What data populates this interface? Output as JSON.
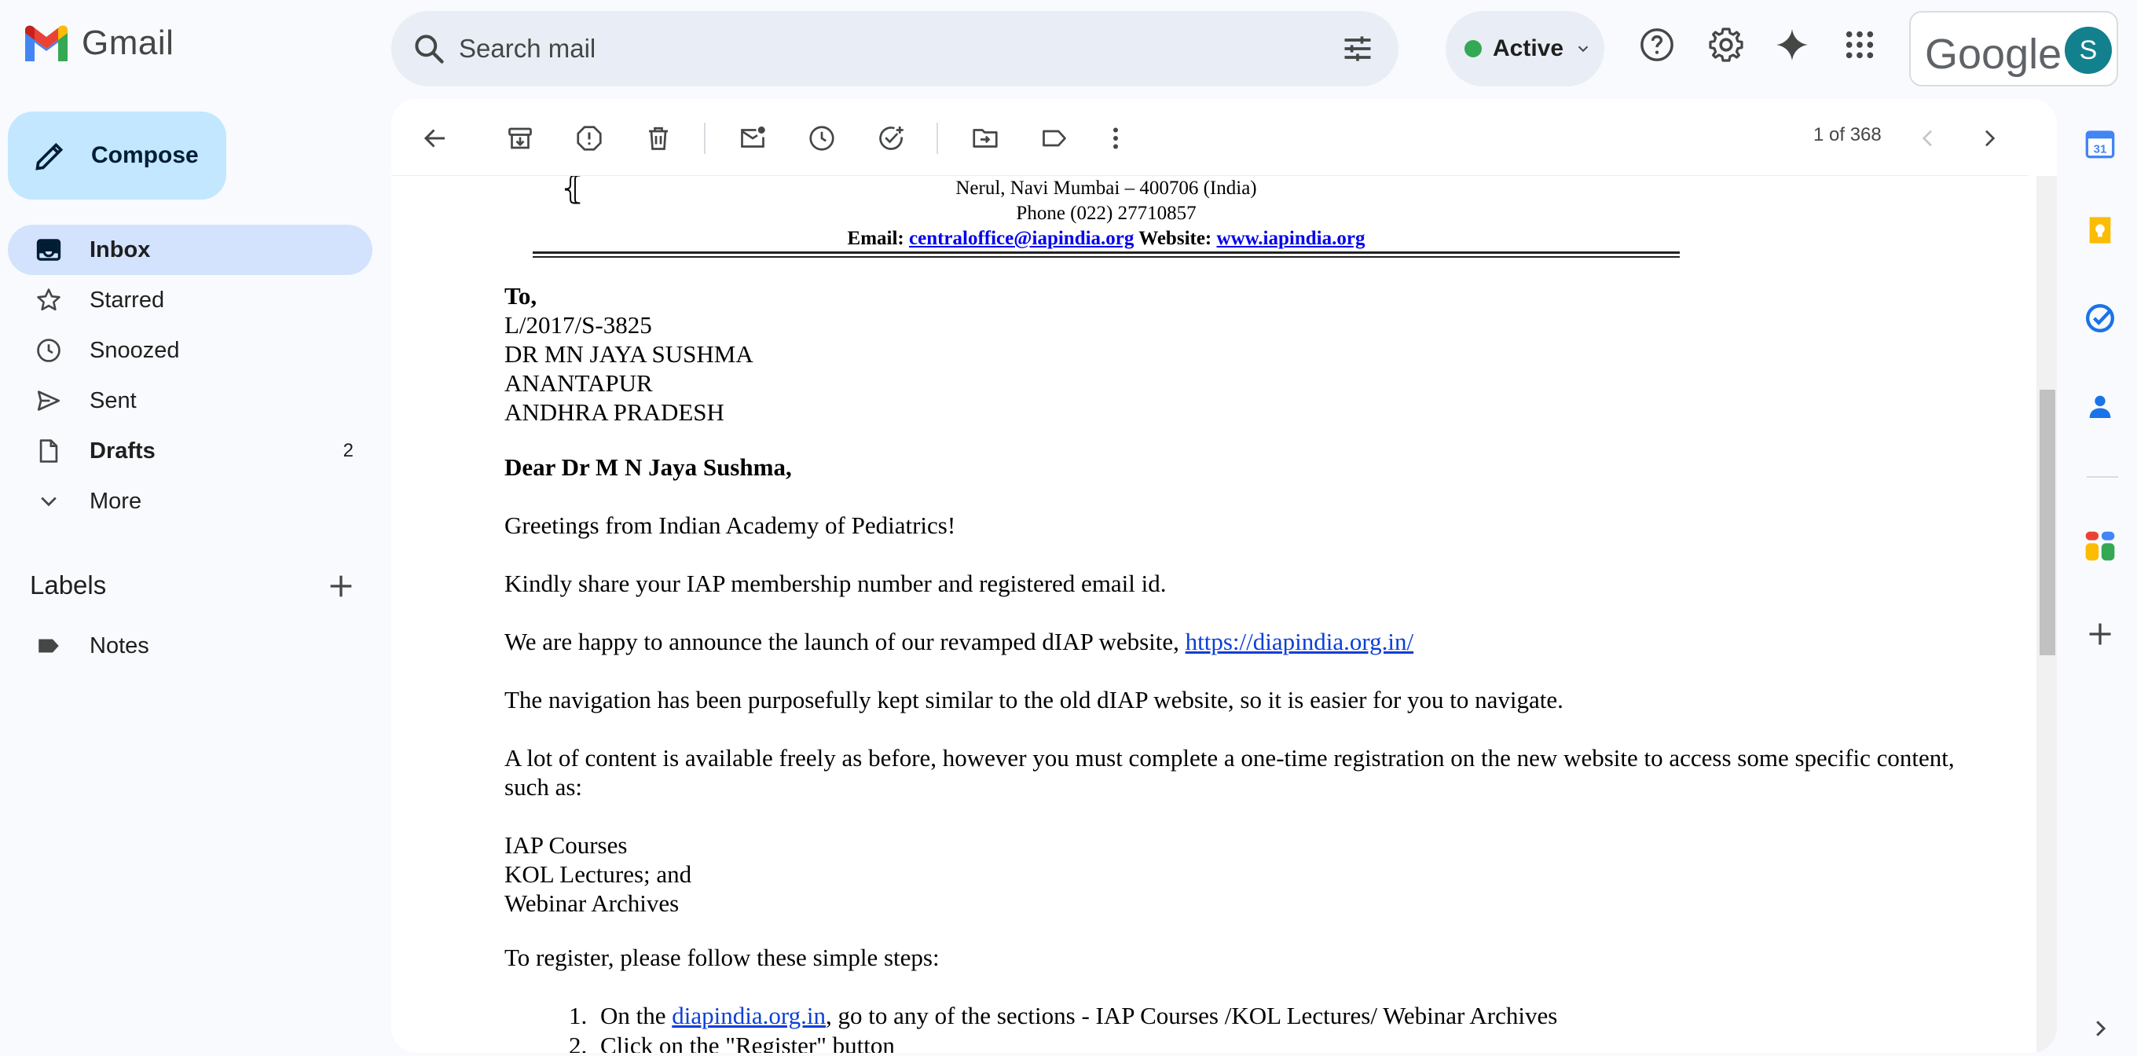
{
  "app": {
    "name": "Gmail",
    "brand_colors": {
      "red": "#ea4335",
      "blue": "#4285f4",
      "green": "#34a853",
      "yellow": "#fbbc04"
    }
  },
  "search": {
    "placeholder": "Search mail"
  },
  "status": {
    "label": "Active"
  },
  "account": {
    "google_label": "Google",
    "avatar_initial": "S"
  },
  "compose": {
    "label": "Compose"
  },
  "nav": [
    {
      "label": "Inbox",
      "icon": "inbox-icon",
      "active": true
    },
    {
      "label": "Starred",
      "icon": "star-icon"
    },
    {
      "label": "Snoozed",
      "icon": "clock-icon"
    },
    {
      "label": "Sent",
      "icon": "send-icon"
    },
    {
      "label": "Drafts",
      "icon": "draft-icon",
      "count": "2"
    },
    {
      "label": "More",
      "icon": "chevron-down-icon"
    }
  ],
  "labels": {
    "heading": "Labels",
    "items": [
      {
        "label": "Notes",
        "icon": "label-icon"
      }
    ]
  },
  "toolbar": {
    "pager": "1 of 368"
  },
  "email": {
    "letterhead": {
      "address": "Nerul, Navi Mumbai – 400706 (India)",
      "phone": "Phone (022) 27710857",
      "email_label": "Email:",
      "email_link": "centraloffice@iapindia.org",
      "website_label": "Website:",
      "website_link": "www.iapindia.org"
    },
    "to_label": "To,",
    "recipient": [
      "L/2017/S-3825",
      "DR MN JAYA SUSHMA",
      "ANANTAPUR",
      "ANDHRA PRADESH"
    ],
    "salutation": "Dear Dr M N Jaya Sushma,",
    "greeting": "Greetings from Indian Academy of Pediatrics!",
    "request": "Kindly share your IAP membership number and registered email id.",
    "announce_text": "We are happy to announce the launch of our revamped dIAP website, ",
    "announce_link": "https://diapindia.org.in/",
    "navigation": "The navigation has been purposefully kept similar to the old dIAP website, so it is easier for you to navigate.",
    "content_line1": "A lot of content is available freely as before, however you must complete a one-time registration on the new website to access some specific content,",
    "content_line2": "such as:",
    "content_items": [
      "IAP Courses",
      "KOL Lectures; and",
      "Webinar Archives"
    ],
    "register_intro": "To register, please follow these simple steps:",
    "steps": [
      {
        "num": "1.",
        "pre": "On the ",
        "link": "diapindia.org.in",
        "post": ", go to any of the sections - IAP Courses /KOL Lectures/ Webinar Archives"
      },
      {
        "num": "2.",
        "text": "Click on the \"Register\" button"
      }
    ]
  }
}
